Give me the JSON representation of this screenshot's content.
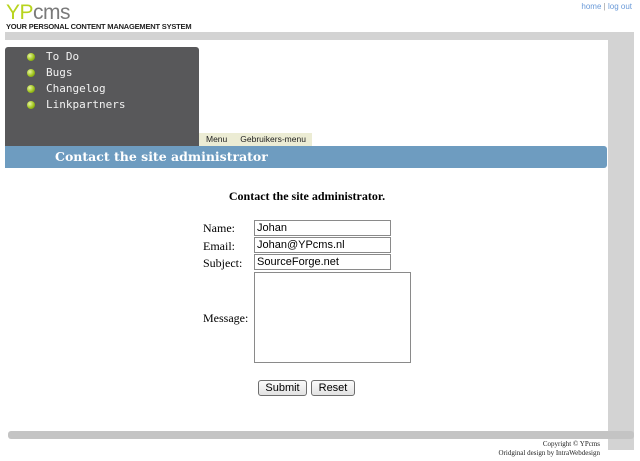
{
  "brand": {
    "logo_y": "Y",
    "logo_p": "P",
    "logo_cms": "cms",
    "tagline": "YOUR PERSONAL CONTENT MANAGEMENT SYSTEM"
  },
  "toplinks": {
    "home": "home",
    "separator": "|",
    "logout": "log out"
  },
  "sidebar": {
    "items": [
      {
        "label": "To Do",
        "icon": "green-bullet-icon"
      },
      {
        "label": "Bugs",
        "icon": "green-bullet-icon"
      },
      {
        "label": "Changelog",
        "icon": "green-bullet-icon"
      },
      {
        "label": "Linkpartners",
        "icon": "green-bullet-icon"
      }
    ]
  },
  "tabs": [
    {
      "label": "Menu"
    },
    {
      "label": "Gebruikers-menu"
    }
  ],
  "page": {
    "title": "Contact the site administrator",
    "heading": "Contact the site administrator."
  },
  "form": {
    "name_label": "Name:",
    "name_value": "Johan",
    "email_label": "Email:",
    "email_value": "Johan@YPcms.nl",
    "subject_label": "Subject:",
    "subject_value": "SourceForge.net",
    "message_label": "Message:",
    "message_value": "",
    "submit_label": "Submit",
    "reset_label": "Reset"
  },
  "footer": {
    "copyright": "Copyright © YPcms",
    "design": "Oridginal design by IntraWebdesign"
  },
  "colors": {
    "sidebar_bg": "#58585a",
    "titlebar_bg": "#6e9cc0",
    "tab_bg": "#ececd4",
    "logo_accent": "#b8d41e",
    "link": "#6a9ad8"
  }
}
